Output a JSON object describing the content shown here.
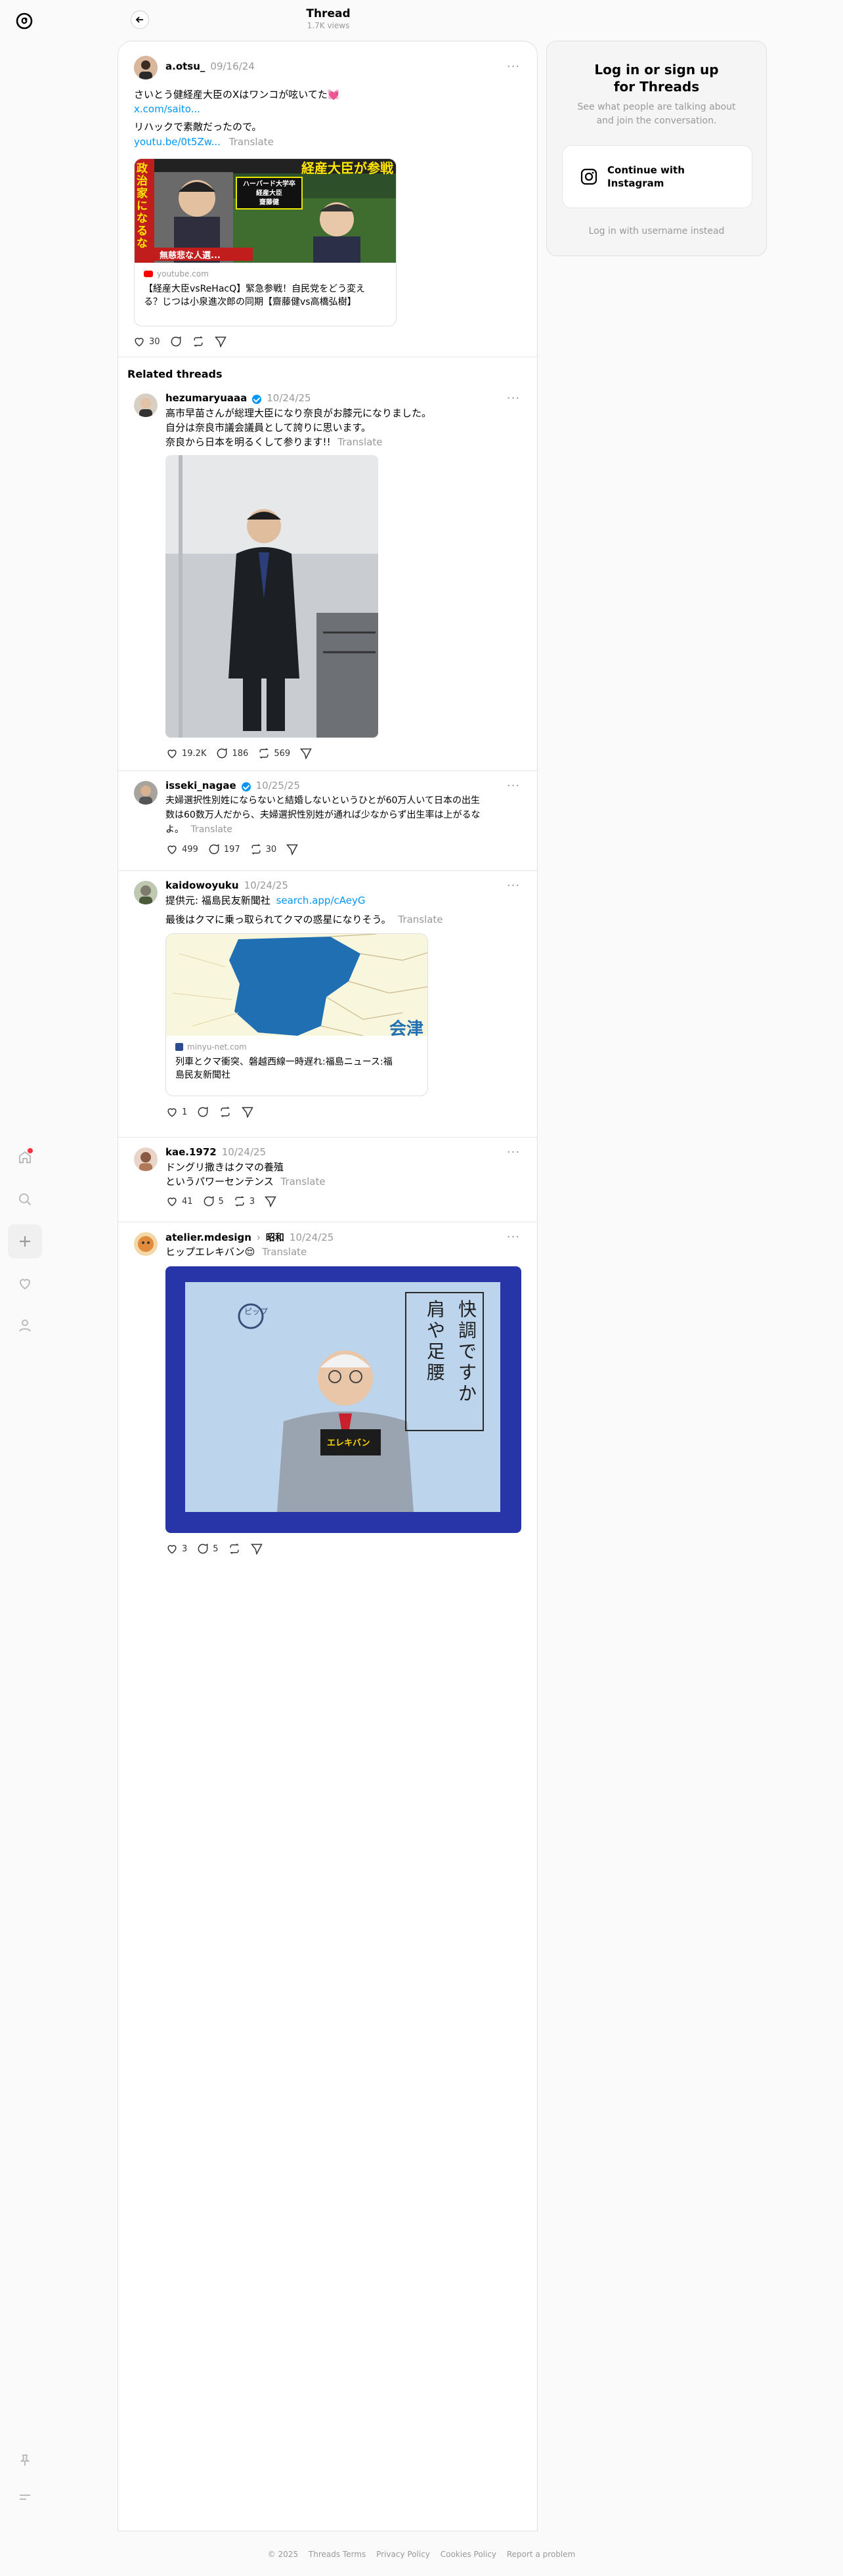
{
  "header": {
    "title": "Thread",
    "views": "1.7K views"
  },
  "main_post": {
    "username": "a.otsu_",
    "date": "09/16/24",
    "line1": "さいとう健経産大臣のXはワンコが呟いてた💓",
    "link1": "x.com/saito...",
    "line2": "リハックで素敵だったので。",
    "link2": "youtu.be/0t5Zw...",
    "translate": "Translate",
    "thumb_caption_right": "経産大臣が参戦",
    "thumb_box_lines": [
      "ハーバード大学卒",
      "経産大臣",
      "齋藤健"
    ],
    "thumb_left_text": "政治家になるな",
    "thumb_bottom": "無慈悲な人選...",
    "card_domain": "youtube.com",
    "card_title_1": "【経産大臣vsReHacQ】緊急参戦！自民党をどう変え",
    "card_title_2": "る？じつは小泉進次郎の同期【齋藤健vs高橋弘樹】",
    "likes": "30"
  },
  "related": {
    "heading": "Related threads"
  },
  "posts": [
    {
      "username": "hezumaryuaaa",
      "date": "10/24/25",
      "lines": [
        "高市早苗さんが総理大臣になり奈良がお膝元になりました。",
        "自分は奈良市議会議員として誇りに思います。",
        "奈良から日本を明るくして参ります!!"
      ],
      "translate": "Translate",
      "likes": "19.2K",
      "replies": "186",
      "reposts": "569"
    },
    {
      "username": "isseki_nagae",
      "date": "10/25/25",
      "lines": [
        "夫婦選択性別姓にならないと結婚しないというひとが60万人いて日本の出生",
        "数は60数万人だから、夫婦選択性別姓が通れば少なからず出生率は上がるな"
      ],
      "line_last": "よ。",
      "translate": "Translate",
      "likes": "499",
      "replies": "197",
      "reposts": "30"
    },
    {
      "username": "kaidowoyuku",
      "date": "10/24/25",
      "source_prefix": "提供元: 福島民友新聞社",
      "source_link": "search.app/cAeyG",
      "body": "最後はクマに乗っ取られてクマの惑星になりそう。",
      "translate": "Translate",
      "map_label": "会津",
      "card_domain": "minyu-net.com",
      "card_title_1": "列車とクマ衝突、磐越西線一時遅れ:福島ニュース:福",
      "card_title_2": "島民友新聞社",
      "likes": "1"
    },
    {
      "username": "kae.1972",
      "date": "10/24/25",
      "lines": [
        "ドングリ撒きはクマの養殖",
        "というパワーセンテンス"
      ],
      "translate": "Translate",
      "likes": "41",
      "replies": "5",
      "reposts": "3"
    },
    {
      "username": "atelier.mdesign",
      "topic": "昭和",
      "date": "10/24/25",
      "body": "ヒップエレキバン😌",
      "translate": "Translate",
      "photo_text_1": "快調ですか",
      "photo_text_2": "肩や足腰",
      "photo_brand": "ピップ",
      "photo_product": "エレキバン",
      "likes": "3",
      "replies": "5"
    }
  ],
  "login": {
    "title_1": "Log in or sign up",
    "title_2": "for Threads",
    "sub_1": "See what people are talking about",
    "sub_2": "and join the conversation.",
    "ig_1": "Continue with",
    "ig_2": "Instagram",
    "alt": "Log in with username instead"
  },
  "footer": {
    "copyright": "© 2025",
    "links": [
      "Threads Terms",
      "Privacy Policy",
      "Cookies Policy",
      "Report a problem"
    ]
  },
  "colors": {
    "accent": "#0095f6",
    "notification": "#ff3040",
    "muted": "#999999"
  }
}
